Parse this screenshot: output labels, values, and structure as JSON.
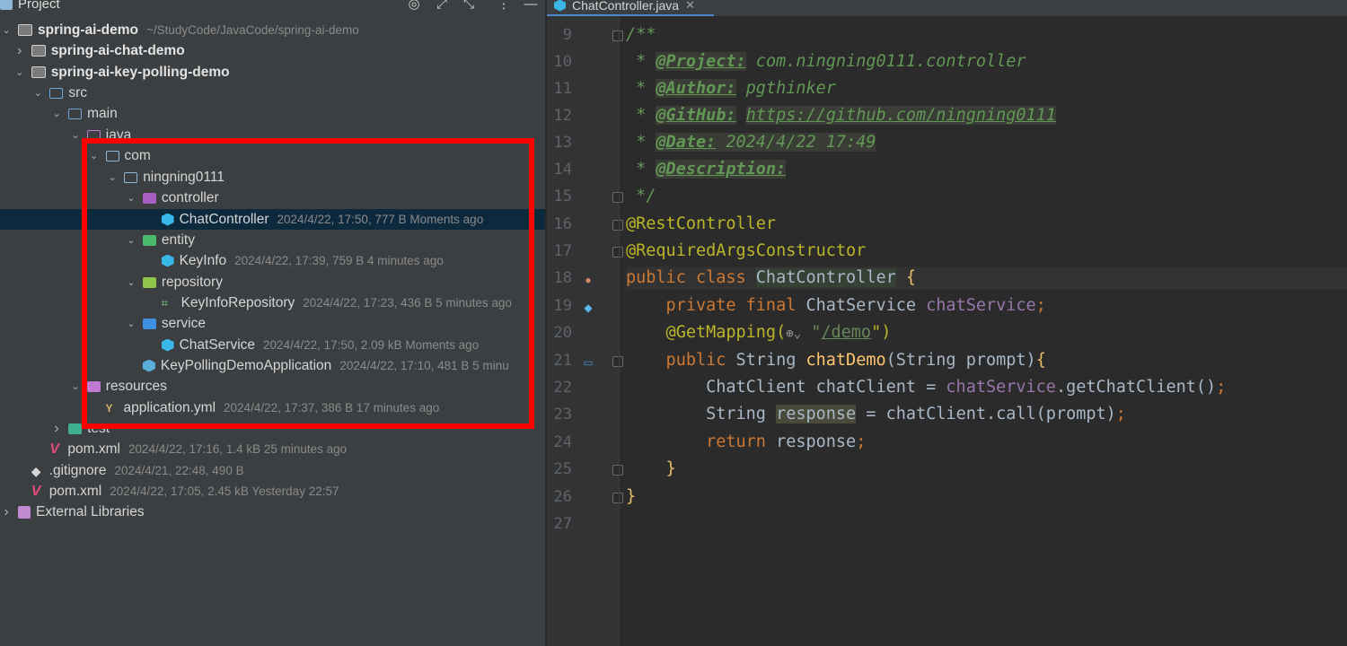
{
  "project_panel": {
    "title": "Project",
    "tree": [
      {
        "depth": 0,
        "arrow": "down",
        "icon": "module-folder",
        "name": "spring-ai-demo",
        "bold": true,
        "meta": "~/StudyCode/JavaCode/spring-ai-demo"
      },
      {
        "depth": 1,
        "arrow": "right",
        "icon": "module-folder",
        "name": "spring-ai-chat-demo",
        "bold": true,
        "meta": ""
      },
      {
        "depth": 1,
        "arrow": "down",
        "icon": "module-folder",
        "name": "spring-ai-key-polling-demo",
        "bold": true,
        "meta": ""
      },
      {
        "depth": 2,
        "arrow": "down",
        "icon": "src-folder",
        "name": "src",
        "bold": false,
        "meta": ""
      },
      {
        "depth": 3,
        "arrow": "down",
        "icon": "src-folder",
        "name": "main",
        "bold": false,
        "meta": ""
      },
      {
        "depth": 4,
        "arrow": "down",
        "icon": "java-folder",
        "name": "java",
        "bold": false,
        "meta": ""
      },
      {
        "depth": 5,
        "arrow": "down",
        "icon": "folder",
        "name": "com",
        "bold": false,
        "meta": ""
      },
      {
        "depth": 6,
        "arrow": "down",
        "icon": "folder",
        "name": "ningning0111",
        "bold": false,
        "meta": ""
      },
      {
        "depth": 7,
        "arrow": "down",
        "icon": "controller-package",
        "name": "controller",
        "bold": false,
        "meta": ""
      },
      {
        "depth": 8,
        "arrow": "none",
        "icon": "class",
        "name": "ChatController",
        "bold": false,
        "meta": "2024/4/22, 17:50, 777 B Moments ago",
        "selected": true
      },
      {
        "depth": 7,
        "arrow": "down",
        "icon": "entity-package",
        "name": "entity",
        "bold": false,
        "meta": ""
      },
      {
        "depth": 8,
        "arrow": "none",
        "icon": "class",
        "name": "KeyInfo",
        "bold": false,
        "meta": "2024/4/22, 17:39, 759 B 4 minutes ago"
      },
      {
        "depth": 7,
        "arrow": "down",
        "icon": "repository-package",
        "name": "repository",
        "bold": false,
        "meta": ""
      },
      {
        "depth": 8,
        "arrow": "none",
        "icon": "interface",
        "name": "KeyInfoRepository",
        "bold": false,
        "meta": "2024/4/22, 17:23, 436 B 5 minutes ago"
      },
      {
        "depth": 7,
        "arrow": "down",
        "icon": "service-package",
        "name": "service",
        "bold": false,
        "meta": ""
      },
      {
        "depth": 8,
        "arrow": "none",
        "icon": "class",
        "name": "ChatService",
        "bold": false,
        "meta": "2024/4/22, 17:50, 2.09 kB Moments ago"
      },
      {
        "depth": 7,
        "arrow": "none",
        "icon": "app-class",
        "name": "KeyPollingDemoApplication",
        "bold": false,
        "meta": "2024/4/22, 17:10, 481 B 5 minu"
      },
      {
        "depth": 4,
        "arrow": "down",
        "icon": "resources-folder",
        "name": "resources",
        "bold": false,
        "meta": ""
      },
      {
        "depth": 5,
        "arrow": "none",
        "icon": "yaml-file",
        "name": "application.yml",
        "bold": false,
        "meta": "2024/4/22, 17:37, 386 B 17 minutes ago"
      },
      {
        "depth": 3,
        "arrow": "right",
        "icon": "test-folder",
        "name": "test",
        "bold": false,
        "meta": ""
      },
      {
        "depth": 2,
        "arrow": "none",
        "icon": "maven-file",
        "name": "pom.xml",
        "bold": false,
        "meta": "2024/4/22, 17:16, 1.4 kB 25 minutes ago"
      },
      {
        "depth": 1,
        "arrow": "none",
        "icon": "git-file",
        "name": ".gitignore",
        "bold": false,
        "meta": "2024/4/21, 22:48, 490 B"
      },
      {
        "depth": 1,
        "arrow": "none",
        "icon": "maven-file",
        "name": "pom.xml",
        "bold": false,
        "meta": "2024/4/22, 17:05, 2.45 kB Yesterday 22:57"
      },
      {
        "depth": 0,
        "arrow": "right",
        "icon": "library",
        "name": "External Libraries",
        "bold": false,
        "meta": ""
      }
    ]
  },
  "editor": {
    "tab_label": "ChatController.java",
    "line_numbers": [
      "9",
      "10",
      "11",
      "12",
      "13",
      "14",
      "15",
      "16",
      "17",
      "18",
      "19",
      "20",
      "21",
      "22",
      "23",
      "24",
      "25",
      "26",
      "27"
    ],
    "code": {
      "l9": "/**",
      "l10_star": " * ",
      "l10_tag": "@Project:",
      "l10_val": " com.ningning0111.controller",
      "l11_star": " * ",
      "l11_tag": "@Author:",
      "l11_val": " pgthinker",
      "l12_star": " * ",
      "l12_tag": "@GitHub:",
      "l12_val": "https://github.com/ningning0111",
      "l13_star": " * ",
      "l13_tag": "@Date:",
      "l13_val": " 2024/4/22 17:49",
      "l14_star": " * ",
      "l14_tag": "@Description:",
      "l15": " */",
      "l16": "@RestController",
      "l17": "@RequiredArgsConstructor",
      "l18_kw": "public class ",
      "l18_name": "ChatController",
      "l18_brace": " {",
      "l19_kw": "    private final ",
      "l19_type": "ChatService ",
      "l19_field": "chatService",
      "l19_end": ";",
      "l20_ann": "    @GetMapping(",
      "l20_q": "\"",
      "l20_path": "/demo",
      "l20_end": "\")",
      "l21_kw": "    public ",
      "l21_type": "String ",
      "l21_method": "chatDemo",
      "l21_params": "(String prompt)",
      "l21_brace": "{",
      "l22_a": "        ChatClient chatClient = ",
      "l22_field": "chatService",
      "l22_b": ".getChatClient()",
      "l22_end": ";",
      "l23_a": "        String ",
      "l23_var": "response",
      "l23_b": " = chatClient.call(prompt)",
      "l23_end": ";",
      "l24_kw": "        return ",
      "l24_b": "response",
      "l24_end": ";",
      "l25": "    }",
      "l26": "}",
      "l27": ""
    }
  }
}
